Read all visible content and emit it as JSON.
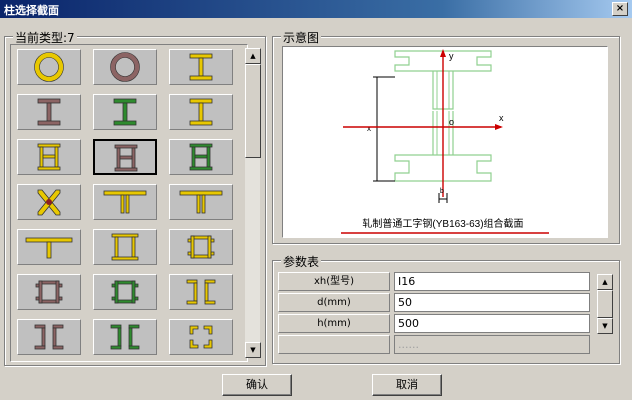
{
  "window": {
    "title": "柱选择截面",
    "close_label": "×"
  },
  "current_type": {
    "label": "当前类型:7"
  },
  "type_grid": {
    "items": [
      {
        "name": "circular-tube-icon",
        "shape": "ring",
        "color": "#e8c800"
      },
      {
        "name": "round-tube-icon",
        "shape": "ring",
        "color": "#8c6464"
      },
      {
        "name": "h-beam-icon",
        "shape": "I",
        "color": "#e8c800"
      },
      {
        "name": "i-beam-icon",
        "shape": "I",
        "color": "#8c6464"
      },
      {
        "name": "i-beam-green-icon",
        "shape": "I",
        "color": "#2e8b2e"
      },
      {
        "name": "i-beam-gold-icon",
        "shape": "I",
        "color": "#e8c800"
      },
      {
        "name": "double-i-beam-icon",
        "shape": "doubleI",
        "color": "#e8c800"
      },
      {
        "name": "double-i-brown-icon",
        "shape": "doubleI",
        "color": "#8c6464"
      },
      {
        "name": "double-i-green-icon",
        "shape": "doubleI",
        "color": "#2e8b2e"
      },
      {
        "name": "cross-angle-icon",
        "shape": "X",
        "color": "#e8c800"
      },
      {
        "name": "double-t-icon",
        "shape": "doubleT",
        "color": "#e8c800"
      },
      {
        "name": "double-t-small-icon",
        "shape": "doubleT",
        "color": "#e8c800"
      },
      {
        "name": "t-section-icon",
        "shape": "T",
        "color": "#e8c800"
      },
      {
        "name": "double-channel-box-icon",
        "shape": "boxChannel",
        "color": "#e8c800"
      },
      {
        "name": "channel-box-icon",
        "shape": "boxBracket",
        "color": "#e8c800"
      },
      {
        "name": "brown-bracket-box-icon",
        "shape": "boxBracket",
        "color": "#8c6464"
      },
      {
        "name": "green-bracket-box-icon",
        "shape": "boxBracket",
        "color": "#2e8b2e"
      },
      {
        "name": "double-channel-icon",
        "shape": "doubleChannel",
        "color": "#e8c800"
      },
      {
        "name": "double-channel-brown-icon",
        "shape": "doubleChannel",
        "color": "#8c6464"
      },
      {
        "name": "double-channel-green-icon",
        "shape": "doubleChannel",
        "color": "#2e8b2e"
      },
      {
        "name": "corner-box-icon",
        "shape": "cornerBox",
        "color": "#e8c800"
      }
    ],
    "selected_index": 7
  },
  "diagram": {
    "label": "示意图",
    "caption": "轧制普通工字钢(YB163-63)组合截面",
    "axis_x": "x",
    "axis_y": "y",
    "origin": "o",
    "dim_width": "b",
    "dim_height": "x"
  },
  "params": {
    "label": "参数表",
    "rows": [
      {
        "label": "xh(型号)",
        "value": "I16"
      },
      {
        "label": "d(mm)",
        "value": "50"
      },
      {
        "label": "h(mm)",
        "value": "500"
      },
      {
        "label": "",
        "value": "......"
      }
    ]
  },
  "buttons": {
    "ok": "确认",
    "cancel": "取消"
  },
  "colors": {
    "section_line": "#90d090",
    "axis": "#cc0000",
    "dim": "#000000"
  }
}
